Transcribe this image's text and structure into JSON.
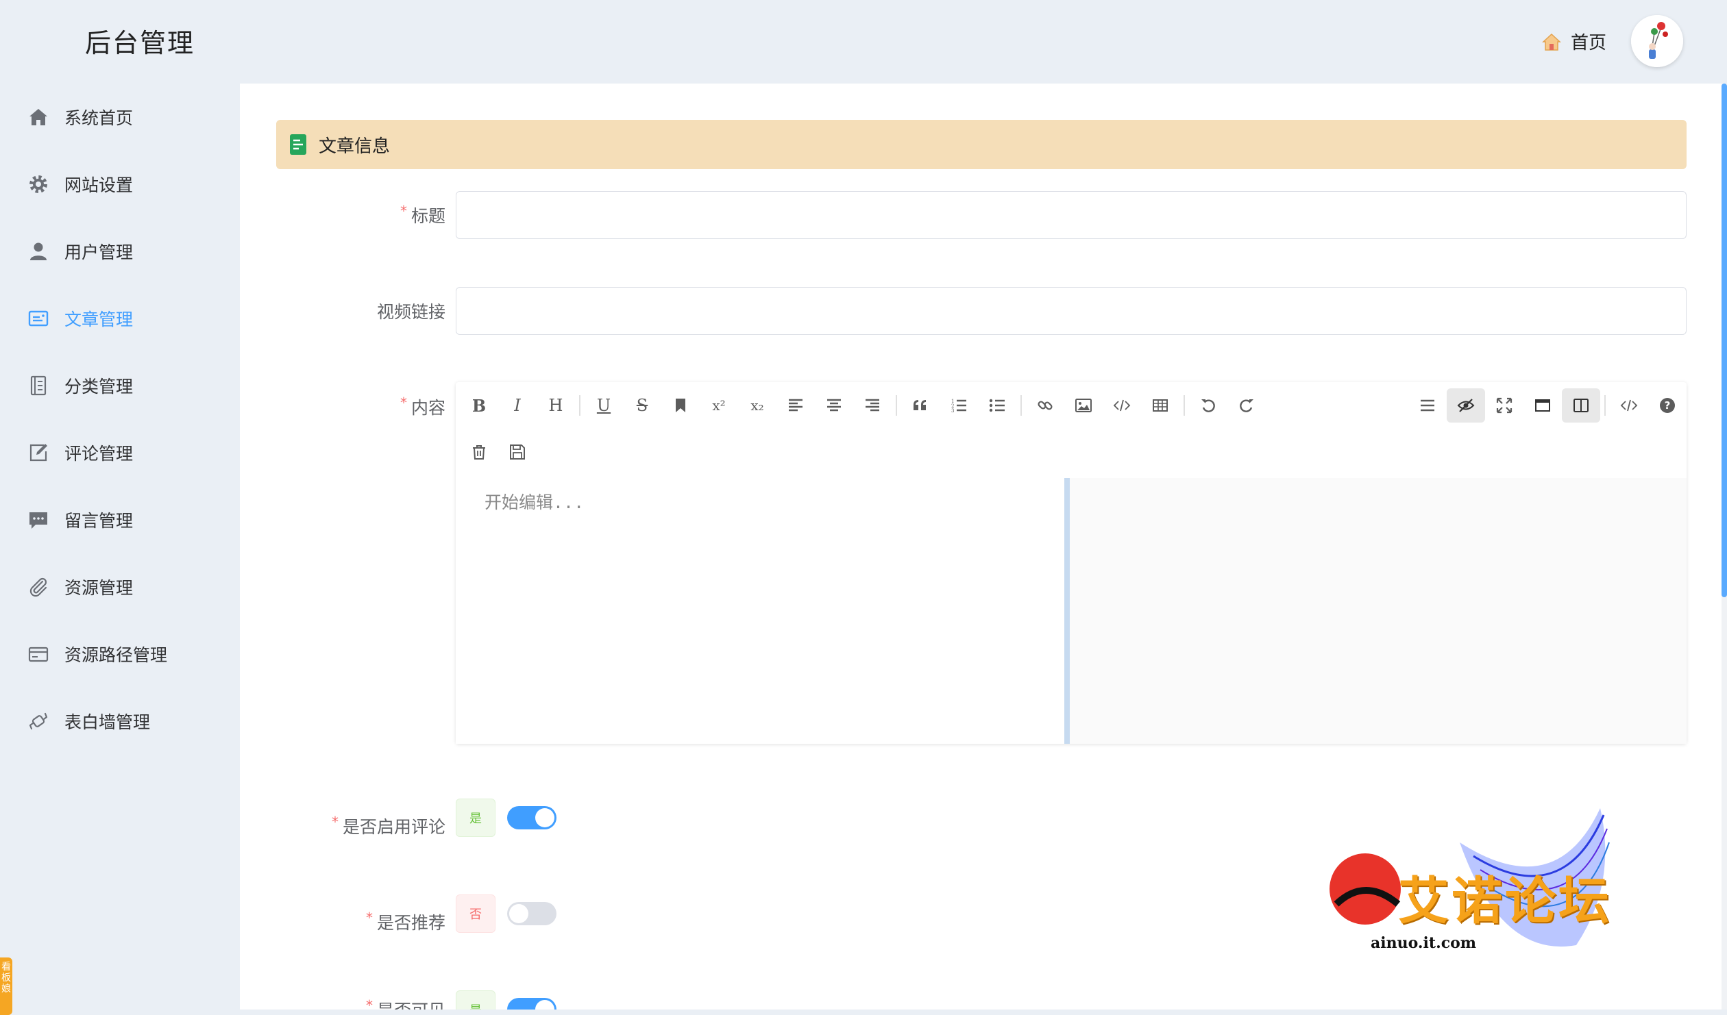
{
  "header": {
    "title": "后台管理",
    "home_label": "首页"
  },
  "sidebar": {
    "items": [
      {
        "label": "系统首页",
        "icon": "home-icon"
      },
      {
        "label": "网站设置",
        "icon": "gear-icon"
      },
      {
        "label": "用户管理",
        "icon": "user-icon"
      },
      {
        "label": "文章管理",
        "icon": "article-icon",
        "active": true
      },
      {
        "label": "分类管理",
        "icon": "category-icon"
      },
      {
        "label": "评论管理",
        "icon": "edit-icon"
      },
      {
        "label": "留言管理",
        "icon": "message-icon"
      },
      {
        "label": "资源管理",
        "icon": "paperclip-icon"
      },
      {
        "label": "资源路径管理",
        "icon": "card-icon"
      },
      {
        "label": "表白墙管理",
        "icon": "candy-icon"
      }
    ],
    "side_tab": "看板娘"
  },
  "form": {
    "section_title": "文章信息",
    "title_label": "标题",
    "title_value": "",
    "video_label": "视频链接",
    "video_value": "",
    "content_label": "内容",
    "editor_placeholder": "开始编辑...",
    "comment_label": "是否启用评论",
    "comment_tag": "是",
    "comment_enabled": true,
    "recommend_label": "是否推荐",
    "recommend_tag": "否",
    "recommend_enabled": false,
    "visible_label": "是否可见",
    "visible_tag": "是",
    "visible_enabled": true
  },
  "toolbar": {
    "bold": "B",
    "italic": "I",
    "heading": "H",
    "underline": "U",
    "strike": "S",
    "superscript": "x²",
    "subscript": "x₂"
  },
  "watermark": {
    "text": "艾诺论坛",
    "url": "ainuo.it.com"
  },
  "colors": {
    "accent": "#409eff",
    "section_bg": "#f5deb8",
    "required": "#f56c6c"
  }
}
